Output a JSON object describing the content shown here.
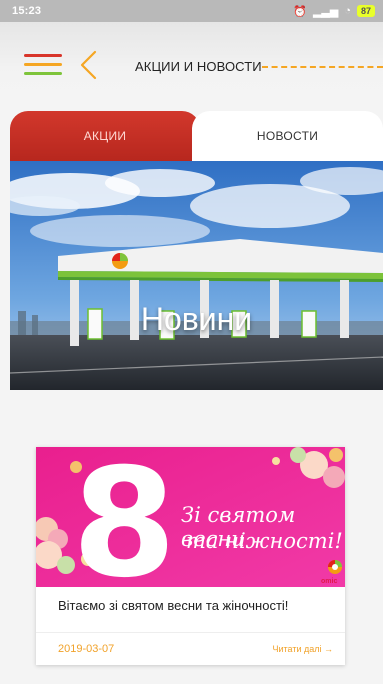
{
  "status_bar": {
    "time": "15:23",
    "battery": "87"
  },
  "header": {
    "title": "АКЦИИ И НОВОСТИ"
  },
  "tabs": [
    {
      "label": "АКЦИИ"
    },
    {
      "label": "НОВОСТИ"
    }
  ],
  "hero": {
    "title": "Новини"
  },
  "news": [
    {
      "banner_number": "8",
      "banner_line1": "Зі святом весни",
      "banner_line2": "та ніжності!",
      "brand": "omic",
      "text": "Вітаємо зі святом весни та жіночності!",
      "date": "2019-03-07",
      "read_more": "Читати далі →"
    }
  ],
  "colors": {
    "accent": "#f1a22a",
    "promo_tab": "#c52f25",
    "banner": "#ee2f9b",
    "brand_green": "#6cbf2f"
  }
}
